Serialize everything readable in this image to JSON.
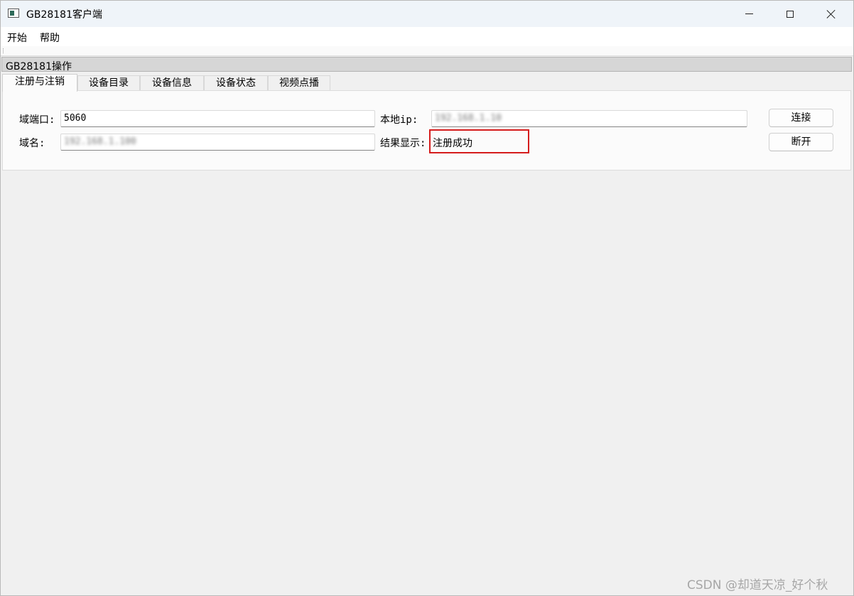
{
  "window": {
    "title": "GB28181客户端",
    "icon": "app-window-icon"
  },
  "menu": {
    "items": [
      {
        "label": "开始"
      },
      {
        "label": "帮助"
      }
    ]
  },
  "group": {
    "title": "GB28181操作"
  },
  "tabs": [
    {
      "label": "注册与注销",
      "active": true
    },
    {
      "label": "设备目录",
      "active": false
    },
    {
      "label": "设备信息",
      "active": false
    },
    {
      "label": "设备状态",
      "active": false
    },
    {
      "label": "视频点播",
      "active": false
    }
  ],
  "form": {
    "domain_port_label": "域端口:",
    "domain_port_value": "5060",
    "domain_name_label": "域名:",
    "domain_name_value": "192.168.1.100",
    "local_ip_label": "本地ip:",
    "local_ip_value": "192.168.1.10",
    "result_label": "结果显示:",
    "result_value": "注册成功"
  },
  "buttons": {
    "connect": "连接",
    "disconnect": "断开"
  },
  "highlight_color": "#d51c1c",
  "watermark": "CSDN @却道天凉_好个秋"
}
